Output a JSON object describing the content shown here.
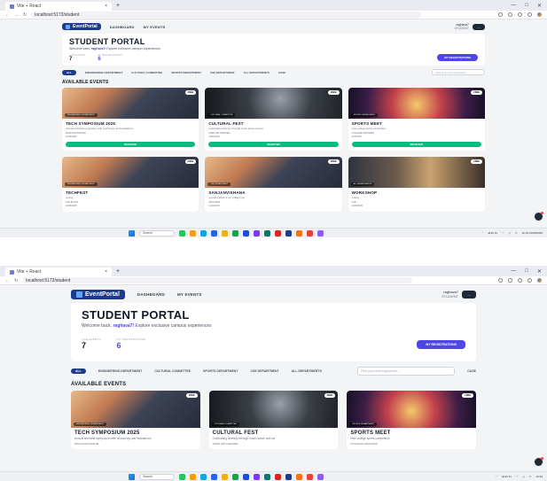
{
  "browser": {
    "tab_title": "Vite + React",
    "url": "localhost:5173/student",
    "newtab": "+",
    "close": "×"
  },
  "nav": {
    "brand": "EventPortal",
    "links": [
      "DASHBOARD",
      "MY EVENTS"
    ],
    "user_name": "raghava7",
    "user_role": "STUDENT",
    "avatar_label": "..."
  },
  "header": {
    "title": "STUDENT PORTAL",
    "welcome_prefix": "Welcome back,",
    "welcome_user": "raghava7!",
    "welcome_suffix": "Explore exclusive campus experiences",
    "stat1_label": "LIVE EVENTS",
    "stat1_value": "7",
    "stat2_label": "MY REGISTRATIONS",
    "stat2_value": "6",
    "my_reg_button": "MY REGISTRATIONS"
  },
  "filters": {
    "chips": [
      "ALL",
      "ENGINEERING DEPARTMENT",
      "CULTURAL COMMITTEE",
      "SPORTS DEPARTMENT",
      "CSE DEPARTMENT",
      "ALL DEPARTMENTS",
      "CASE"
    ],
    "search_placeholder": "Find your next experience..."
  },
  "section_title": "AVAILABLE EVENTS",
  "events": [
    {
      "name": "TECH SYMPOSIUM 2025",
      "desc": "Annual technical symposium with workshops and hackathons",
      "category": "ENGINEERING DEPARTMENT",
      "badge": "FREE",
      "meta1": "MAIN AUDITORIUM",
      "meta2": "10/15/2025",
      "cta": "REGISTER"
    },
    {
      "name": "CULTURAL FEST",
      "desc": "Celebrating diversity through music dance and art",
      "category": "CULTURAL COMMITTEE",
      "badge": "FREE",
      "meta1": "OPEN AIR THEATER",
      "meta2": "10/20/2025",
      "cta": "REGISTER"
    },
    {
      "name": "SPORTS MEET",
      "desc": "Inter-college sports competition",
      "category": "SPORTS DEPARTMENT",
      "badge": "FREE",
      "meta1": "COLLEGE GROUNDS",
      "meta2": "11/5/2025",
      "cta": "REGISTER"
    },
    {
      "name": "TECHFEST",
      "desc": "coding",
      "category": "ENGINEERING DEPARTMENT",
      "badge": "FREE",
      "meta1": "CSE BLOCK",
      "meta2": "10/30/2025",
      "cta": "REGISTER"
    },
    {
      "name": "SANJANVISHANA",
      "desc": "annual festival of our college fest",
      "category": "CSE DEPARTMENT",
      "badge": "FREE",
      "meta1": "GROUNDS",
      "meta2": "11/12/2025",
      "cta": "REGISTER"
    },
    {
      "name": "WORKSHOP",
      "desc": "coding",
      "category": "ALL DEPARTMENTS",
      "badge": "FREE",
      "meta1": "LAB",
      "meta2": "11/20/2025",
      "cta": "REGISTER"
    }
  ],
  "taskbar": {
    "search": "Search",
    "lang": "ENG IN",
    "time": "12:33",
    "date": "10/05/2025"
  }
}
